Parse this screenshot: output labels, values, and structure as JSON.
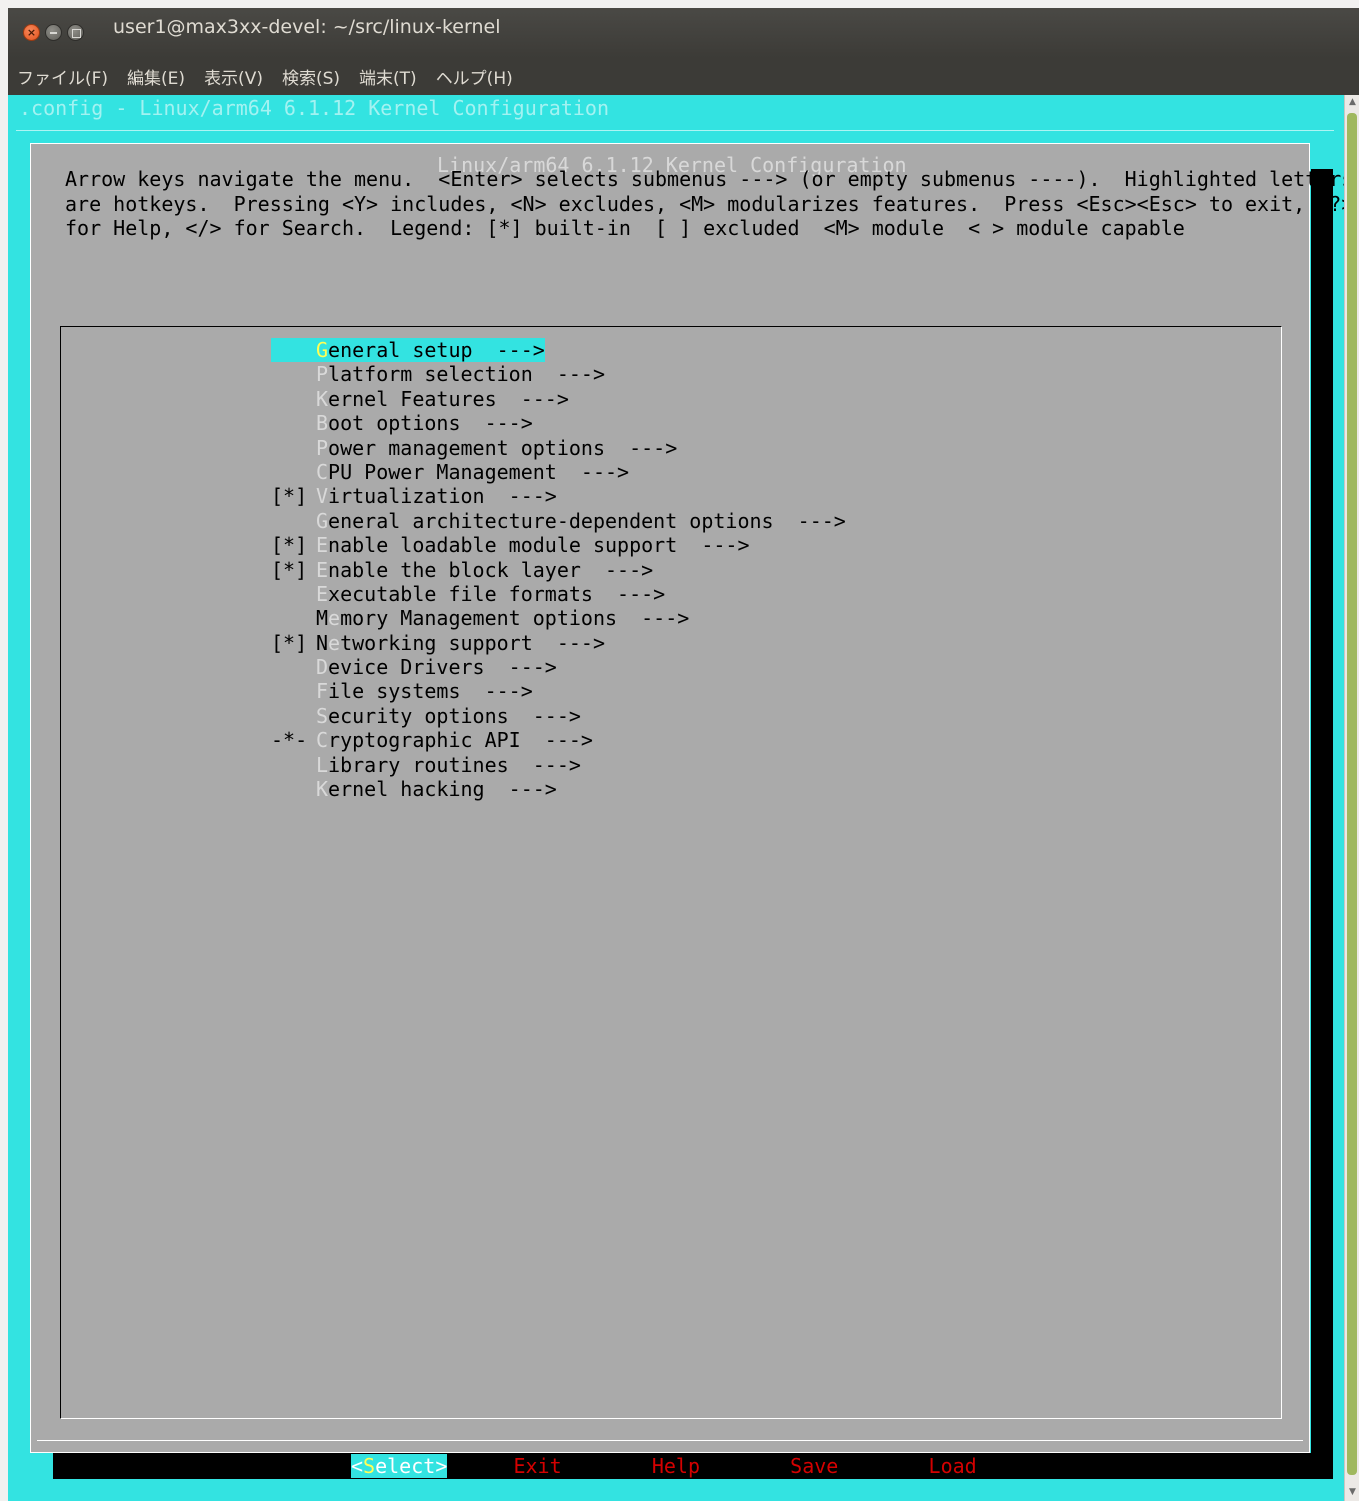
{
  "window": {
    "title": "user1@max3xx-devel: ~/src/linux-kernel",
    "close_glyph": "×",
    "buttons": [
      "close-icon",
      "minimize-icon",
      "maximize-icon"
    ]
  },
  "menubar": [
    "ファイル(F)",
    "編集(E)",
    "表示(V)",
    "検索(S)",
    "端末(T)",
    "ヘルプ(H)"
  ],
  "terminal": {
    "top_title": ".config - Linux/arm64 6.1.12 Kernel Configuration",
    "colors": {
      "background": "#33e3e1",
      "dialog": "#aaaaaa",
      "hotkey": "#ffff55",
      "button_hotkey": "#d40000"
    }
  },
  "dialog": {
    "title": "Linux/arm64 6.1.12 Kernel Configuration",
    "help_lines": [
      "Arrow keys navigate the menu.  <Enter> selects submenus ---> (or empty submenus ----).  Highlighted letters",
      "are hotkeys.  Pressing <Y> includes, <N> excludes, <M> modularizes features.  Press <Esc><Esc> to exit, <?>",
      "for Help, </> for Search.  Legend: [*] built-in  [ ] excluded  <M> module  < > module capable"
    ],
    "entries": [
      {
        "mark": "",
        "hotkey": "G",
        "rest": "eneral setup  --->",
        "selected": true
      },
      {
        "mark": "",
        "hotkey": "P",
        "rest": "latform selection  --->"
      },
      {
        "mark": "",
        "hotkey": "K",
        "rest": "ernel Features  --->"
      },
      {
        "mark": "",
        "hotkey": "B",
        "rest": "oot options  --->"
      },
      {
        "mark": "",
        "hotkey": "P",
        "rest": "ower management options  --->"
      },
      {
        "mark": "",
        "hotkey": "C",
        "rest": "PU Power Management  --->"
      },
      {
        "mark": "[*]",
        "hotkey": "V",
        "rest": "irtualization  --->"
      },
      {
        "mark": "",
        "hotkey": "G",
        "rest": "eneral architecture-dependent options  --->"
      },
      {
        "mark": "[*]",
        "hotkey": "E",
        "rest": "nable loadable module support  --->"
      },
      {
        "mark": "[*]",
        "hotkey": "E",
        "rest": "nable the block layer  --->"
      },
      {
        "mark": "",
        "hotkey": "E",
        "rest": "xecutable file formats  --->"
      },
      {
        "mark": "",
        "prefix": "M",
        "hotkey": "e",
        "rest": "mory Management options  --->"
      },
      {
        "mark": "[*]",
        "prefix": "N",
        "hotkey": "e",
        "rest": "tworking support  --->"
      },
      {
        "mark": "",
        "hotkey": "D",
        "rest": "evice Drivers  --->"
      },
      {
        "mark": "",
        "hotkey": "F",
        "rest": "ile systems  --->"
      },
      {
        "mark": "",
        "hotkey": "S",
        "rest": "ecurity options  --->"
      },
      {
        "mark": "-*-",
        "hotkey": "C",
        "rest": "ryptographic API  --->"
      },
      {
        "mark": "",
        "hotkey": "L",
        "rest": "ibrary routines  --->"
      },
      {
        "mark": "",
        "hotkey": "K",
        "rest": "ernel hacking  --->"
      }
    ],
    "buttons": [
      {
        "name": "select",
        "open": "<",
        "hotkey": "S",
        "rest": "elect",
        "close": ">",
        "active": true
      },
      {
        "name": "exit",
        "open": "< ",
        "hotkey": "E",
        "rest": "xit",
        "close": " >"
      },
      {
        "name": "help",
        "open": "< ",
        "hotkey": "H",
        "rest": "elp",
        "close": " >"
      },
      {
        "name": "save",
        "open": "< ",
        "hotkey": "S",
        "rest": "ave",
        "close": " >"
      },
      {
        "name": "load",
        "open": "< ",
        "hotkey": "L",
        "rest": "oad",
        "close": " >"
      }
    ]
  }
}
